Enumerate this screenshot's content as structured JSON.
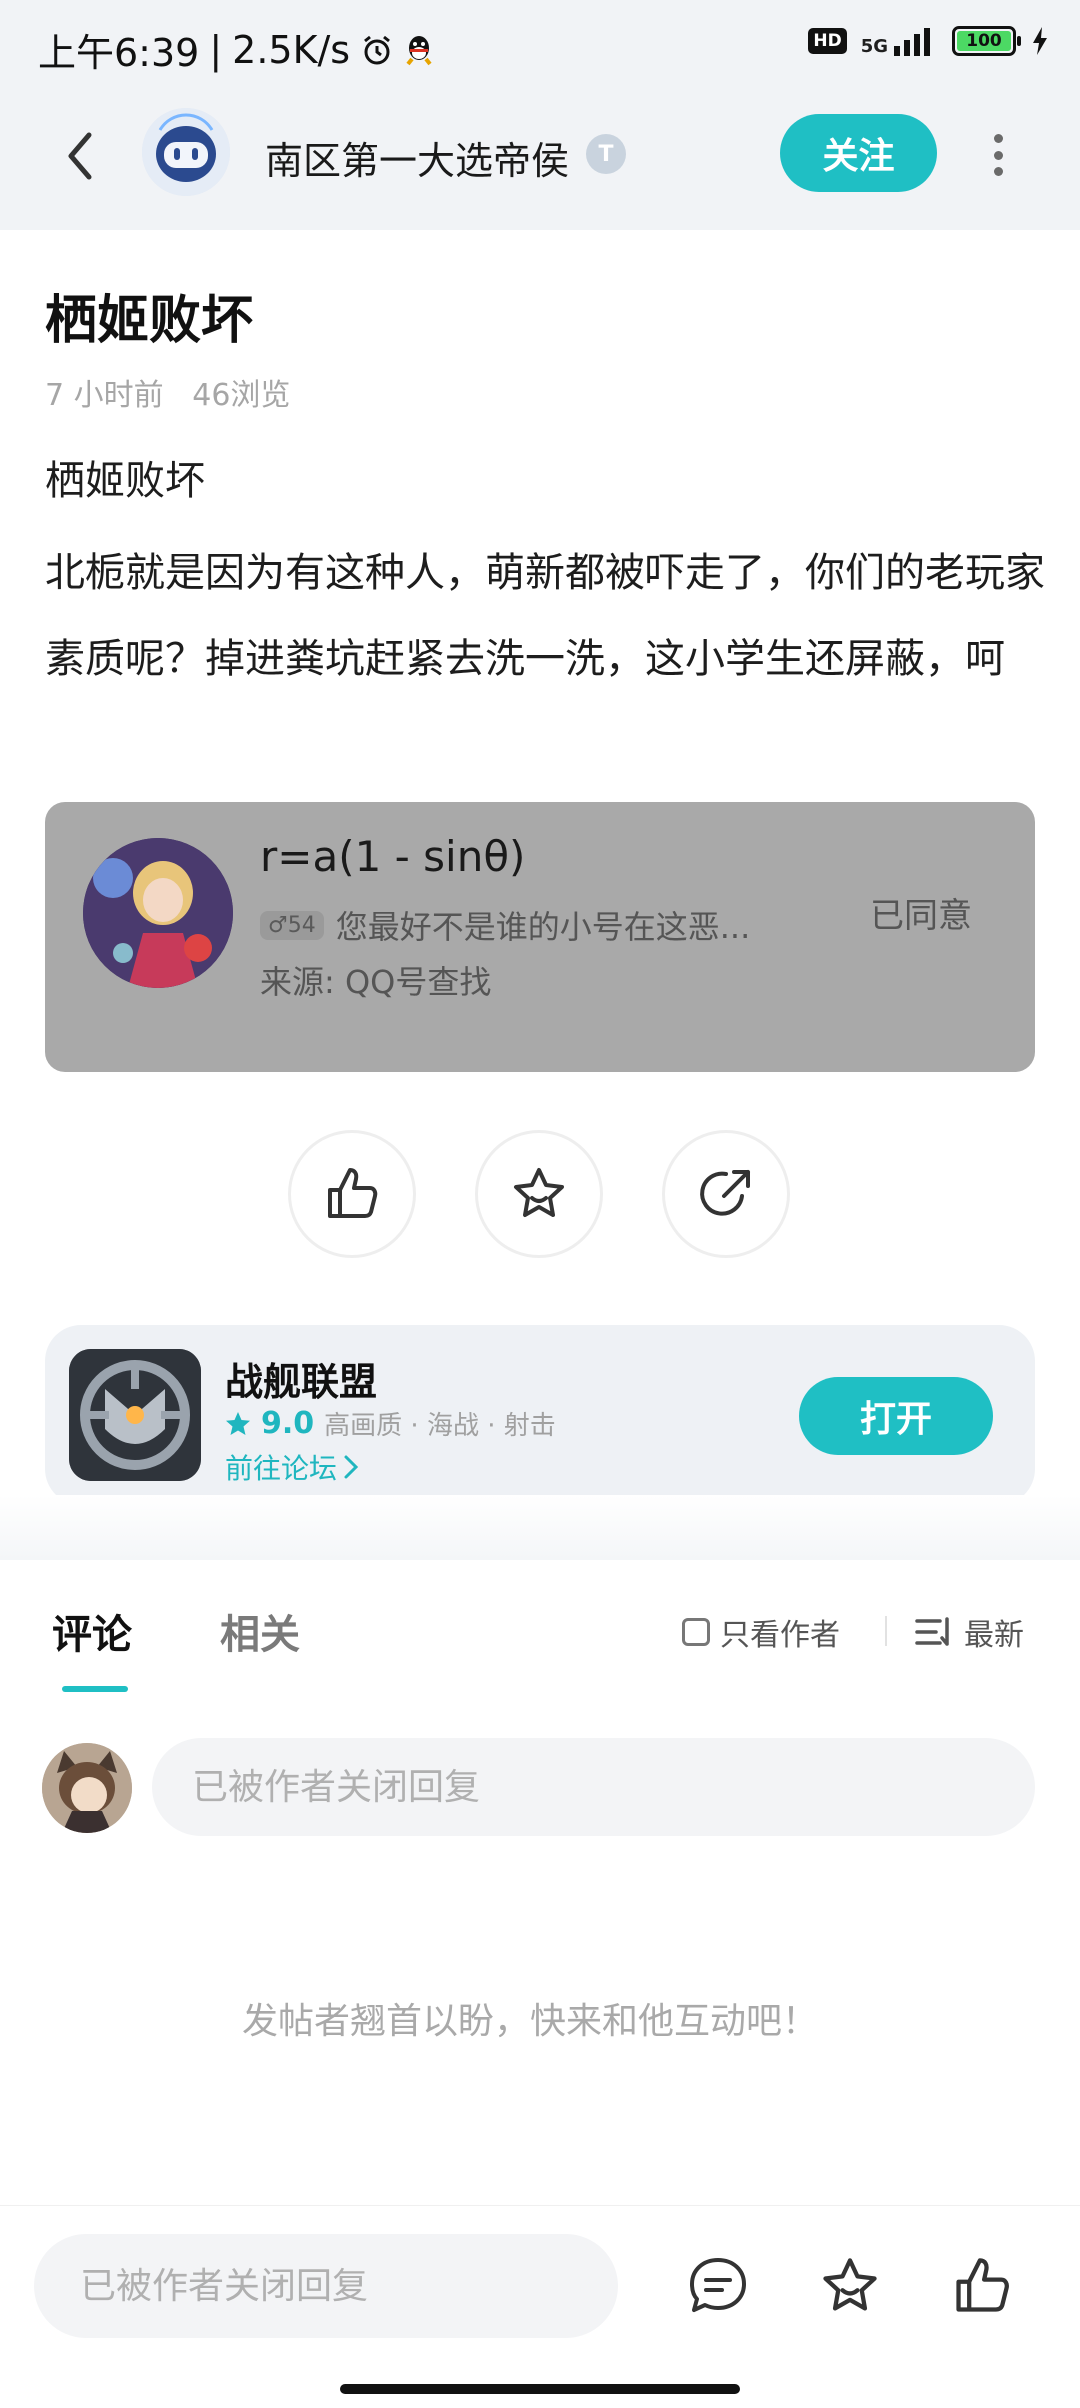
{
  "status_bar": {
    "time": "上午6:39",
    "speed": "2.5K/s",
    "hd": "HD",
    "network": "5G",
    "battery": "100"
  },
  "header": {
    "author_name": "南区第一大选帝侯",
    "level_badge": "T",
    "follow_label": "关注"
  },
  "post": {
    "title": "栖姬败坏",
    "meta": "7 小时前   46浏览",
    "body_line1": "栖姬败坏",
    "body_para": "北栀就是因为有这种人，萌新都被吓走了，你们的老玩家素质呢？掉进粪坑赶紧去洗一洗，这小学生还屏蔽，呵"
  },
  "embed": {
    "name": "r=a(1 - sinθ)",
    "gender_age": "♂54",
    "message": "您最好不是谁的小号在这恶...",
    "source": "来源: QQ号查找",
    "status": "已同意"
  },
  "app": {
    "name": "战舰联盟",
    "rating": "9.0",
    "tags": "高画质 · 海战 · 射击",
    "forum_link": "前往论坛",
    "open_label": "打开"
  },
  "comments": {
    "tab_comment": "评论",
    "tab_related": "相关",
    "only_author": "只看作者",
    "sort": "最新",
    "reply_placeholder": "已被作者关闭回复",
    "empty_text": "发帖者翘首以盼，快来和他互动吧！"
  },
  "bottom_bar": {
    "input_placeholder": "已被作者关闭回复"
  },
  "colors": {
    "accent": "#1fbfc4",
    "embed_bg": "#a9a9a9"
  }
}
